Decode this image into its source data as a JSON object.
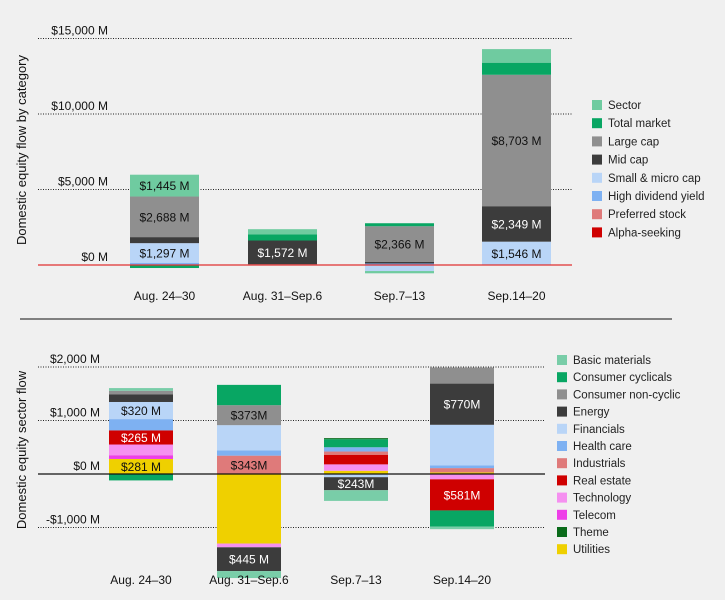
{
  "colors": {
    "Sector": "#6fcba0",
    "Total market": "#08a663",
    "Large cap": "#8f8f8f",
    "Mid cap": "#3c3c3c",
    "Small & micro cap": "#b9d5f7",
    "High dividend yield": "#7eb1f2",
    "Preferred stock": "#df7a7a",
    "Alpha-seeking": "#cf0000",
    "Basic materials": "#79cda8",
    "Consumer cyclicals": "#08a663",
    "Consumer non-cyclic": "#8f8f8f",
    "Energy": "#3c3c3c",
    "Financials": "#b9d5f7",
    "Health care": "#7eb1f2",
    "Industrials": "#df7a7a",
    "Real estate": "#cf0000",
    "Technology": "#f590f0",
    "Telecom": "#ee3ee8",
    "Theme": "#0a6a1a",
    "Utilities": "#efd000",
    "zero_line_top": "#e03030",
    "zero_line_bottom": "#111111"
  },
  "chart_data": [
    {
      "type": "bar",
      "stacked": true,
      "title": "",
      "ylabel": "Domestic equity flow by category",
      "xlabel": "",
      "categories": [
        "Aug. 24–30",
        "Aug. 31–Sep.6",
        "Sep.7–13",
        "Sep.14–20"
      ],
      "ylim": [
        -1000,
        15000
      ],
      "yticks": [
        0,
        5000,
        10000,
        15000
      ],
      "ytick_labels": [
        "$0 M",
        "$5,000 M",
        "$10,000 M",
        "$15,000 M"
      ],
      "grid": true,
      "legend": "right",
      "series": [
        {
          "name": "Alpha-seeking",
          "values": [
            0,
            0,
            0,
            0
          ]
        },
        {
          "name": "Preferred stock",
          "values": [
            0,
            50,
            0,
            0
          ]
        },
        {
          "name": "High dividend yield",
          "values": [
            150,
            0,
            100,
            0
          ]
        },
        {
          "name": "Small & micro cap",
          "values": [
            1297,
            0,
            -400,
            1546
          ]
        },
        {
          "name": "Mid cap",
          "values": [
            400,
            1572,
            100,
            2349
          ]
        },
        {
          "name": "Large cap",
          "values": [
            2688,
            0,
            2366,
            8703
          ]
        },
        {
          "name": "Total market",
          "values": [
            -200,
            400,
            200,
            800
          ]
        },
        {
          "name": "Sector",
          "values": [
            1445,
            350,
            -150,
            900
          ]
        }
      ],
      "data_labels": [
        {
          "category": 0,
          "series": "Sector",
          "text": "$1,445 M"
        },
        {
          "category": 0,
          "series": "Large cap",
          "text": "$2,688 M"
        },
        {
          "category": 0,
          "series": "Small & micro cap",
          "text": "$1,297 M"
        },
        {
          "category": 1,
          "series": "Mid cap",
          "text": "$1,572 M"
        },
        {
          "category": 2,
          "series": "Large cap",
          "text": "$2,366 M"
        },
        {
          "category": 3,
          "series": "Large cap",
          "text": "$8,703 M"
        },
        {
          "category": 3,
          "series": "Mid cap",
          "text": "$2,349 M"
        },
        {
          "category": 3,
          "series": "Small & micro cap",
          "text": "$1,546 M"
        }
      ],
      "legend_items": [
        "Sector",
        "Total market",
        "Large cap",
        "Mid cap",
        "Small & micro cap",
        "High dividend yield",
        "Preferred stock",
        "Alpha-seeking"
      ]
    },
    {
      "type": "bar",
      "stacked": true,
      "title": "",
      "ylabel": "Domestic equity sector flow",
      "xlabel": "",
      "categories": [
        "Aug. 24–30",
        "Aug. 31–Sep.6",
        "Sep.7–13",
        "Sep.14–20"
      ],
      "ylim": [
        -1300,
        2000
      ],
      "yticks": [
        -1000,
        0,
        1000,
        2000
      ],
      "ytick_labels": [
        "-$1,000 M",
        "$0 M",
        "$1,000 M",
        "$2,000 M"
      ],
      "grid": true,
      "legend": "right",
      "series": [
        {
          "name": "Utilities",
          "values": [
            281,
            -1300,
            60,
            30
          ]
        },
        {
          "name": "Telecom",
          "values": [
            70,
            0,
            0,
            0
          ]
        },
        {
          "name": "Technology",
          "values": [
            200,
            -70,
            120,
            -100
          ]
        },
        {
          "name": "Real estate",
          "values": [
            265,
            0,
            180,
            -581
          ]
        },
        {
          "name": "Industrials",
          "values": [
            0,
            343,
            60,
            80
          ]
        },
        {
          "name": "Health care",
          "values": [
            210,
            100,
            80,
            50
          ]
        },
        {
          "name": "Financials",
          "values": [
            320,
            470,
            -60,
            760
          ]
        },
        {
          "name": "Energy",
          "values": [
            140,
            -445,
            -243,
            770
          ]
        },
        {
          "name": "Consumer non-cyclic",
          "values": [
            70,
            373,
            0,
            300
          ]
        },
        {
          "name": "Consumer cyclicals",
          "values": [
            -120,
            380,
            150,
            -300
          ]
        },
        {
          "name": "Basic materials",
          "values": [
            50,
            -130,
            -200,
            -50
          ]
        },
        {
          "name": "Theme",
          "values": [
            0,
            0,
            20,
            0
          ]
        }
      ],
      "data_labels": [
        {
          "category": 0,
          "series": "Financials",
          "text": "$320 M"
        },
        {
          "category": 0,
          "series": "Real estate",
          "text": "$265 M"
        },
        {
          "category": 0,
          "series": "Utilities",
          "text": "$281 M"
        },
        {
          "category": 1,
          "series": "Consumer non-cyclic",
          "text": "$373M"
        },
        {
          "category": 1,
          "series": "Industrials",
          "text": "$343M"
        },
        {
          "category": 1,
          "series": "Energy",
          "text": "$445 M"
        },
        {
          "category": 2,
          "series": "Energy",
          "text": "$243M"
        },
        {
          "category": 3,
          "series": "Energy",
          "text": "$770M"
        },
        {
          "category": 3,
          "series": "Real estate",
          "text": "$581M"
        }
      ],
      "legend_items": [
        "Basic materials",
        "Consumer cyclicals",
        "Consumer non-cyclic",
        "Energy",
        "Financials",
        "Health care",
        "Industrials",
        "Real estate",
        "Technology",
        "Telecom",
        "Theme",
        "Utilities"
      ]
    }
  ]
}
